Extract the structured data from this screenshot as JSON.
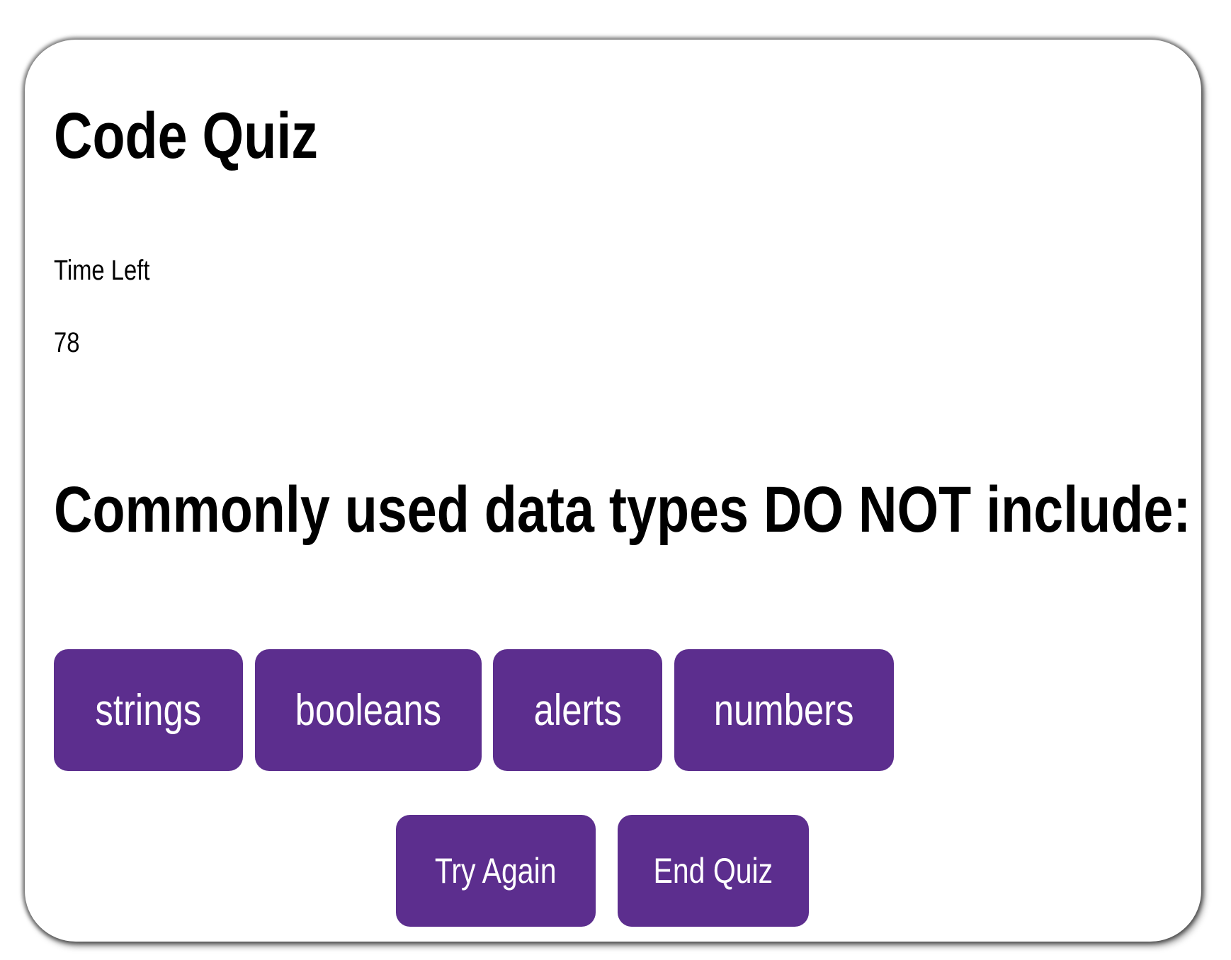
{
  "theme": {
    "accent": "#5c2e8e"
  },
  "header": {
    "title": "Code Quiz"
  },
  "timer": {
    "label": "Time Left",
    "value": "78"
  },
  "question": {
    "text": "Commonly used data types DO NOT include:",
    "answers": [
      "strings",
      "booleans",
      "alerts",
      "numbers"
    ]
  },
  "controls": {
    "try_again": "Try Again",
    "end_quiz": "End Quiz"
  }
}
